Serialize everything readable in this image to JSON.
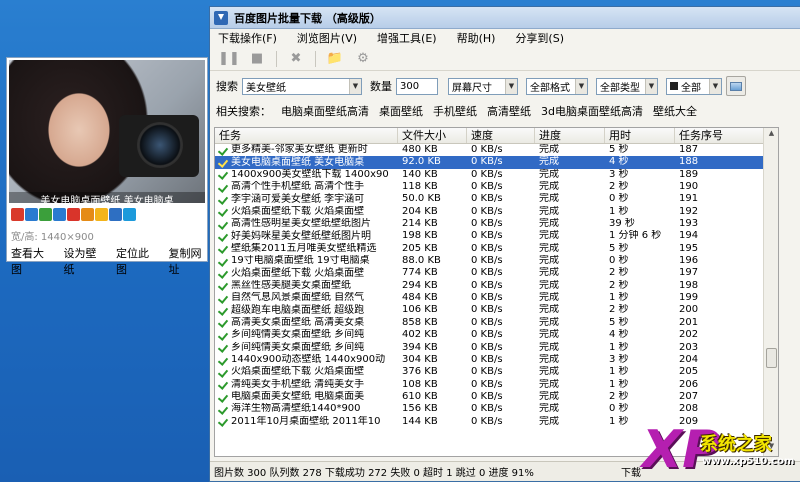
{
  "preview": {
    "caption": "美女电脑桌面壁纸 美女电脑桌",
    "dimensions": "宽/高: 1440×900",
    "links": [
      "查看大图",
      "设为壁纸",
      "定位此图",
      "复制网址"
    ],
    "share_icon_colors": [
      "#d93a2b",
      "#2a7bd0",
      "#3b9f3b",
      "#2a7bd0",
      "#d9342a",
      "#e58b16",
      "#f3b41b",
      "#2e6fc2",
      "#1d9adb"
    ]
  },
  "window": {
    "title": "百度图片批量下载 （高级版）",
    "menu": [
      "下载操作(F)",
      "浏览图片(V)",
      "增强工具(E)",
      "帮助(H)",
      "分享到(S)"
    ],
    "toolbar_icons": [
      "pause-icon",
      "stop-icon",
      "delete-icon",
      "folder-icon",
      "settings-icon"
    ],
    "search_label": "搜索",
    "search_value": "美女壁纸",
    "count_label": "数量",
    "count_value": "300",
    "size_filter": "屏幕尺寸",
    "format_filter": "全部格式",
    "type_filter": "全部类型",
    "color_filter": "全部",
    "related_label": "相关搜索：",
    "related_keywords": [
      "电脑桌面壁纸高清",
      "桌面壁纸",
      "手机壁纸",
      "高清壁纸",
      "3d电脑桌面壁纸高清",
      "壁纸大全"
    ]
  },
  "table": {
    "headers": [
      "任务",
      "文件大小",
      "速度",
      "进度",
      "用时",
      "任务序号"
    ],
    "selected_index": 1,
    "rows": [
      [
        "更多精美-邻家美女壁纸 更新时",
        "480 KB",
        "0 KB/s",
        "完成",
        "5 秒",
        "187"
      ],
      [
        "美女电脑桌面壁纸 美女电脑桌",
        "92.0 KB",
        "0 KB/s",
        "完成",
        "4 秒",
        "188"
      ],
      [
        "1400x900美女壁纸下载 1400x90",
        "140 KB",
        "0 KB/s",
        "完成",
        "3 秒",
        "189"
      ],
      [
        "高清个性手机壁纸 高清个性手",
        "118 KB",
        "0 KB/s",
        "完成",
        "2 秒",
        "190"
      ],
      [
        "李宇涵可爱美女壁纸 李宇涵可",
        "50.0 KB",
        "0 KB/s",
        "完成",
        "0 秒",
        "191"
      ],
      [
        "火焰桌面壁纸下载 火焰桌面壁",
        "204 KB",
        "0 KB/s",
        "完成",
        "1 秒",
        "192"
      ],
      [
        "高清性感明星美女壁纸壁纸图片",
        "214 KB",
        "0 KB/s",
        "完成",
        "39 秒",
        "193"
      ],
      [
        "好美妈咪星美女壁纸壁纸图片明",
        "198 KB",
        "0 KB/s",
        "完成",
        "1 分钟 6 秒",
        "194"
      ],
      [
        "壁纸集2011五月唯美女壁纸精选",
        "205 KB",
        "0 KB/s",
        "完成",
        "5 秒",
        "195"
      ],
      [
        "19寸电脑桌面壁纸 19寸电脑桌",
        "88.0 KB",
        "0 KB/s",
        "完成",
        "0 秒",
        "196"
      ],
      [
        "火焰桌面壁纸下载 火焰桌面壁",
        "774 KB",
        "0 KB/s",
        "完成",
        "2 秒",
        "197"
      ],
      [
        "黑丝性感美腿美女桌面壁纸",
        "294 KB",
        "0 KB/s",
        "完成",
        "2 秒",
        "198"
      ],
      [
        "自然气息风景桌面壁纸 自然气",
        "484 KB",
        "0 KB/s",
        "完成",
        "1 秒",
        "199"
      ],
      [
        "超级跑车电脑桌面壁纸 超级跑",
        "106 KB",
        "0 KB/s",
        "完成",
        "2 秒",
        "200"
      ],
      [
        "高清美女桌面壁纸 高清美女桌",
        "858 KB",
        "0 KB/s",
        "完成",
        "5 秒",
        "201"
      ],
      [
        "乡间纯情美女桌面壁纸 乡间纯",
        "402 KB",
        "0 KB/s",
        "完成",
        "4 秒",
        "202"
      ],
      [
        "乡间纯情美女桌面壁纸 乡间纯",
        "394 KB",
        "0 KB/s",
        "完成",
        "1 秒",
        "203"
      ],
      [
        "1440x900动态壁纸 1440x900动",
        "304 KB",
        "0 KB/s",
        "完成",
        "3 秒",
        "204"
      ],
      [
        "火焰桌面壁纸下载 火焰桌面壁",
        "376 KB",
        "0 KB/s",
        "完成",
        "1 秒",
        "205"
      ],
      [
        "清纯美女手机壁纸 清纯美女手",
        "108 KB",
        "0 KB/s",
        "完成",
        "1 秒",
        "206"
      ],
      [
        "电脑桌面美女壁纸 电脑桌面美",
        "610 KB",
        "0 KB/s",
        "完成",
        "2 秒",
        "207"
      ],
      [
        "海洋生物高清壁纸1440*900",
        "156 KB",
        "0 KB/s",
        "完成",
        "0 秒",
        "208"
      ],
      [
        "2011年10月桌面壁纸 2011年10",
        "144 KB",
        "0 KB/s",
        "完成",
        "1 秒",
        "209"
      ]
    ]
  },
  "status": {
    "text": "图片数 300  队列数 278  下载成功 272  失败 0  超时 1  跳过 0  进度 91%",
    "right": "下载"
  },
  "watermark": {
    "brand": "XP",
    "name": "系统之家",
    "url": "www.xp510.com"
  }
}
